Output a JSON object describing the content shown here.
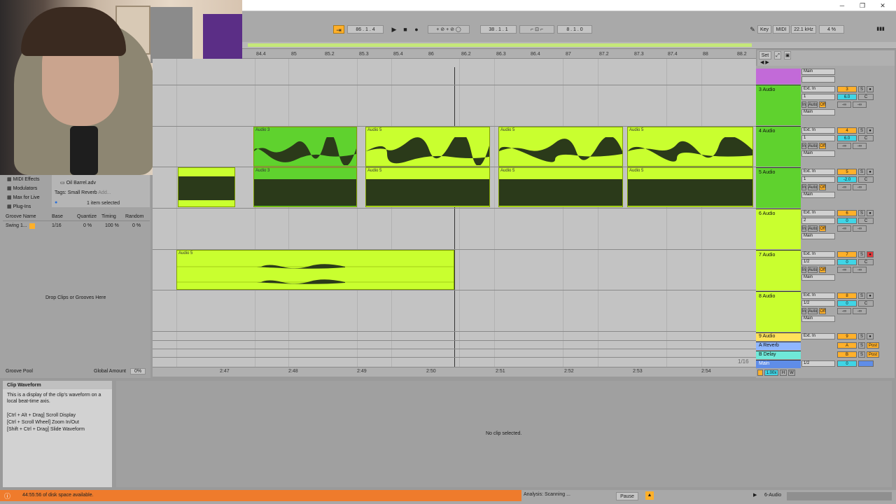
{
  "colors": {
    "clip_green": "#c9ff2f",
    "clip_selected": "#5fd22e",
    "track_green": "#5fd22e",
    "warning": "#ef7b2c",
    "orange": "#ffb02a",
    "cyan": "#3fd5e6"
  },
  "transport": {
    "follow_icon": "follow-icon",
    "arrangement_pos": "86 .  1 .  4",
    "play_icon": "play-icon",
    "stop_icon": "stop-icon",
    "record_icon": "record-icon",
    "loop_start": "38 .  1 .  1",
    "loop_length": "8 .  1 .  0",
    "key_label": "Key",
    "midi_label": "MIDI",
    "sample_rate": "22.1 kHz",
    "cpu": "4 %"
  },
  "ruler": {
    "ticks": [
      "84.4",
      "85",
      "85.2",
      "85.3",
      "85.4",
      "86",
      "86.2",
      "86.3",
      "86.4",
      "87",
      "87.2",
      "87.3",
      "87.4",
      "88",
      "88.2"
    ],
    "set_label": "Set"
  },
  "time_ruler": [
    "2:47",
    "2:48",
    "2:49",
    "2:50",
    "2:51",
    "2:52",
    "2:53",
    "2:54"
  ],
  "grid_label": "1/16",
  "browser": {
    "categories": [
      "MIDI Effects",
      "Modulators",
      "Max for Live",
      "Plug-Ins"
    ],
    "file": "Oil Barrel.adv",
    "tags_label": "Tags:",
    "tag": "Small Reverb",
    "add_label": "Add...",
    "selected": "1 item selected",
    "groove_headers": [
      "Groove Name",
      "Base",
      "Quantize",
      "Timing",
      "Random"
    ],
    "groove_row": {
      "name": "Swing 1...",
      "base": "1/16",
      "quantize": "0 %",
      "timing": "100 %",
      "random": "0 %"
    },
    "drop_text": "Drop Clips or Grooves Here",
    "groove_pool": "Groove Pool",
    "global_amount_label": "Global Amount",
    "global_amount": "0%"
  },
  "clips": {
    "row4": [
      "Audio 3",
      "Audio 5",
      "Audio 5",
      "Audio 5"
    ],
    "row5": [
      "Audio 3",
      "Audio 5",
      "Audio 5",
      "Audio 5"
    ],
    "row7": "Audio 5"
  },
  "tracks": [
    {
      "name": "",
      "route": "Main",
      "num": "",
      "vol": "",
      "pan": "",
      "s": "",
      "rec": false
    },
    {
      "name": "3 Audio",
      "route": "Ext. In",
      "ch": "1",
      "vol": "6.0",
      "num": "3",
      "pan": "C",
      "out": "Main"
    },
    {
      "name": "4 Audio",
      "route": "Ext. In",
      "ch": "1",
      "vol": "6.0",
      "num": "4",
      "pan": "C",
      "out": "Main"
    },
    {
      "name": "5 Audio",
      "route": "Ext. In",
      "ch": "1",
      "vol": "-2.0",
      "num": "5",
      "pan": "C",
      "out": "Main"
    },
    {
      "name": "6 Audio",
      "route": "Ext. In",
      "ch": "2",
      "vol": "0",
      "num": "6",
      "pan": "C",
      "out": "Main"
    },
    {
      "name": "7 Audio",
      "route": "Ext. In",
      "ch": "1/2",
      "vol": "0",
      "num": "7",
      "pan": "C",
      "out": "Main"
    },
    {
      "name": "8 Audio",
      "route": "Ext. In",
      "ch": "1/2",
      "vol": "0",
      "num": "8",
      "pan": "C",
      "out": "Main"
    }
  ],
  "monitor": {
    "in": "In",
    "auto": "Auto",
    "off": "Off",
    "inf": "-∞"
  },
  "returns": [
    {
      "name": "9 Audio",
      "route": "Ext. In",
      "num": "9"
    },
    {
      "name": "A Reverb",
      "num": "A",
      "post": "Post"
    },
    {
      "name": "B Delay",
      "num": "B",
      "post": "Post"
    },
    {
      "name": "Main",
      "route": "1/2",
      "num": "0"
    }
  ],
  "info": {
    "title": "Clip Waveform",
    "body": "This is a display of the clip's waveform on a local beat-time axis.",
    "hints": [
      "[Ctrl + Alt + Drag] Scroll Display",
      "[Ctrl + Scroll Wheel] Zoom In/Out",
      "[Shift + Ctrl + Drag] Slide Waveform"
    ]
  },
  "detail": {
    "empty": "No clip selected."
  },
  "status": {
    "disk": "44:55:56 of disk space available.",
    "analysis": "Analysis: Scanning ...",
    "pause": "Pause",
    "track": "6-Audio"
  },
  "zoom": "1.00x",
  "hw": [
    "H",
    "W"
  ]
}
